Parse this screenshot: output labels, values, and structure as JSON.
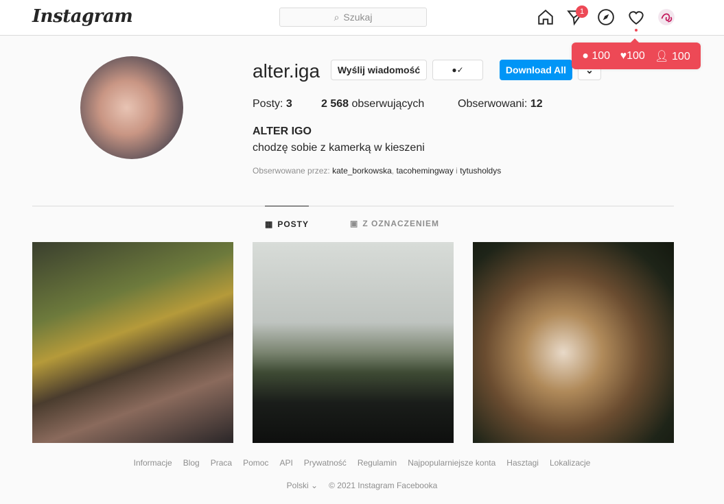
{
  "nav": {
    "logo": "Instagram",
    "search_placeholder": "Szukaj",
    "dm_badge": "1"
  },
  "stats_popup": {
    "comments": "100",
    "likes": "100",
    "followers": "100"
  },
  "profile": {
    "username": "alter.iga",
    "message_button": "Wyślij wiadomość",
    "download_button": "Download All",
    "more": "•••",
    "posts_label": "Posty:",
    "posts": "3",
    "followers": "2 568",
    "followers_label": "obserwujących",
    "following_label": "Obserwowani:",
    "following": "12",
    "full_name": "ALTER IGO",
    "bio": "chodzę sobie z kamerką w kieszeni",
    "followed_by_label": "Obserwowane przez:",
    "followed_by": [
      "kate_borkowska",
      ", ",
      "tacohemingway",
      " i ",
      "tytusholdys"
    ]
  },
  "tabs": [
    {
      "label": "POSTY"
    },
    {
      "label": "Z OZNACZENIEM"
    }
  ],
  "footer": {
    "links": [
      "Informacje",
      "Blog",
      "Praca",
      "Pomoc",
      "API",
      "Prywatność",
      "Regulamin",
      "Najpopularniejsze konta",
      "Hasztagi",
      "Lokalizacje"
    ],
    "language": "Polski",
    "copyright": "© 2021 Instagram Facebooka"
  }
}
